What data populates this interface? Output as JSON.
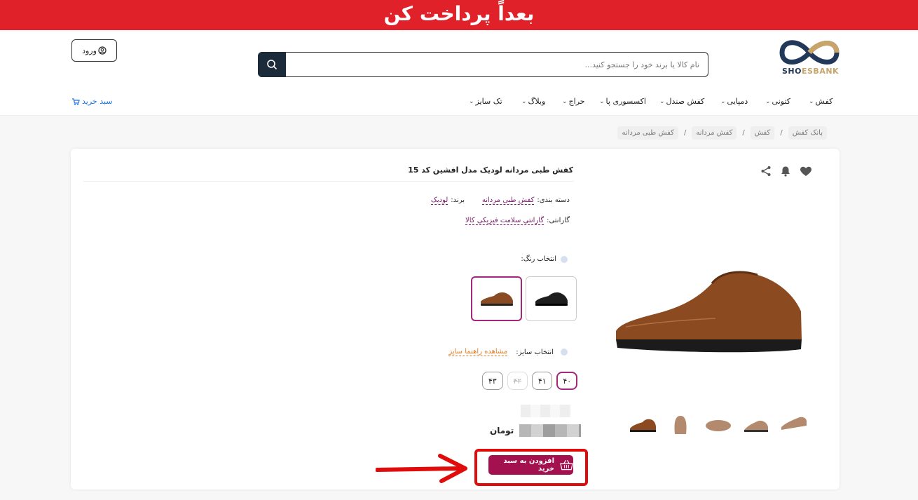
{
  "banner": {
    "text": "بعداً پرداخت کن"
  },
  "header": {
    "logo_text_dark": "SH",
    "logo_text_brand": "ESBANK",
    "search_placeholder": "نام کالا یا برند خود را جستجو کنید...",
    "login_label": "ورود",
    "cart_label": "سبد خرید",
    "nav": [
      {
        "label": "کفش"
      },
      {
        "label": "کتونی"
      },
      {
        "label": "دمپایی"
      },
      {
        "label": "کفش صندل"
      },
      {
        "label": "اکسسوری پا"
      },
      {
        "label": "حراج"
      },
      {
        "label": "وبلاگ"
      },
      {
        "label": "تک سایز"
      }
    ]
  },
  "breadcrumb": [
    "بانک کفش",
    "کفش",
    "کفش مردانه",
    "کفش طبی مردانه"
  ],
  "product": {
    "title": "کفش طبی مردانه لودیک مدل افشین کد 15",
    "category_label": "دسته بندی:",
    "category_value": "کفش طبی مردانه",
    "brand_label": "برند:",
    "brand_value": "لودیک",
    "warranty_label": "گارانتی:",
    "warranty_value": "گارانتی سلامت فیزیکی کالا",
    "color_label": "انتخاب رنگ:",
    "size_label": "انتخاب سایز:",
    "size_guide": "مشاهده راهنما سایز",
    "sizes": [
      {
        "label": "۴۰",
        "state": "selected"
      },
      {
        "label": "۴۱",
        "state": "normal"
      },
      {
        "label": "۴۲",
        "state": "disabled"
      },
      {
        "label": "۴۳",
        "state": "normal"
      }
    ],
    "currency": "تومان",
    "add_to_cart": "افزودن به سبد خرید",
    "colors": [
      "brown",
      "black"
    ]
  },
  "colors": {
    "banner": "#e12129",
    "accent": "#a3124f",
    "highlight": "#e00b0b"
  }
}
